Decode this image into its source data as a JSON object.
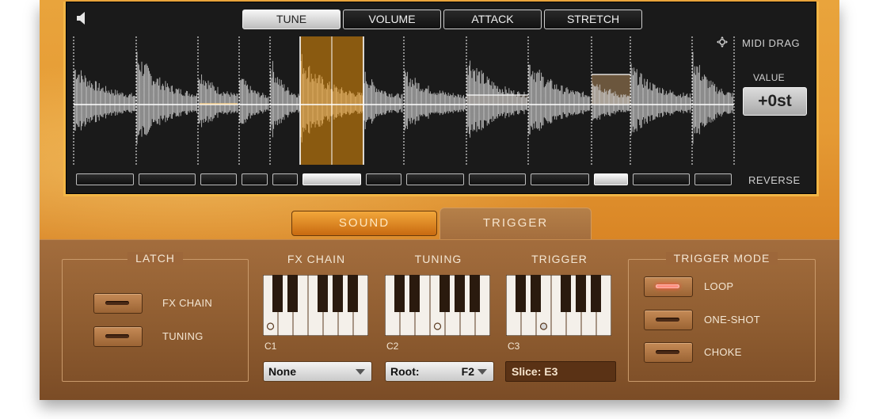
{
  "editor": {
    "mode_tabs": [
      "TUNE",
      "VOLUME",
      "ATTACK",
      "STRETCH"
    ],
    "active_mode": "TUNE",
    "midi_drag_label": "MIDI DRAG",
    "value_label": "VALUE",
    "value": "+0st",
    "reverse_label": "REVERSE",
    "reverse_toggles_on": [
      5,
      10
    ]
  },
  "tabs": {
    "sound": "SOUND",
    "trigger": "TRIGGER",
    "active": "TRIGGER"
  },
  "latch": {
    "title": "LATCH",
    "items": [
      {
        "label": "FX CHAIN",
        "active": false
      },
      {
        "label": "TUNING",
        "active": false
      }
    ]
  },
  "fx_chain": {
    "title": "FX CHAIN",
    "octave": "C1",
    "select_value": "None"
  },
  "tuning": {
    "title": "TUNING",
    "octave": "C2",
    "select_label": "Root:",
    "select_value": "F2"
  },
  "trigger": {
    "title": "TRIGGER",
    "octave": "C3",
    "slice_label": "Slice: E3"
  },
  "trigger_mode": {
    "title": "TRIGGER MODE",
    "items": [
      {
        "label": "LOOP",
        "active": true
      },
      {
        "label": "ONE-SHOT",
        "active": false
      },
      {
        "label": "CHOKE",
        "active": false
      }
    ]
  },
  "colors": {
    "accent": "#e59a34",
    "panel": "#9d673a",
    "selection": "#8a5a10",
    "led_on": "#ff5a48"
  }
}
